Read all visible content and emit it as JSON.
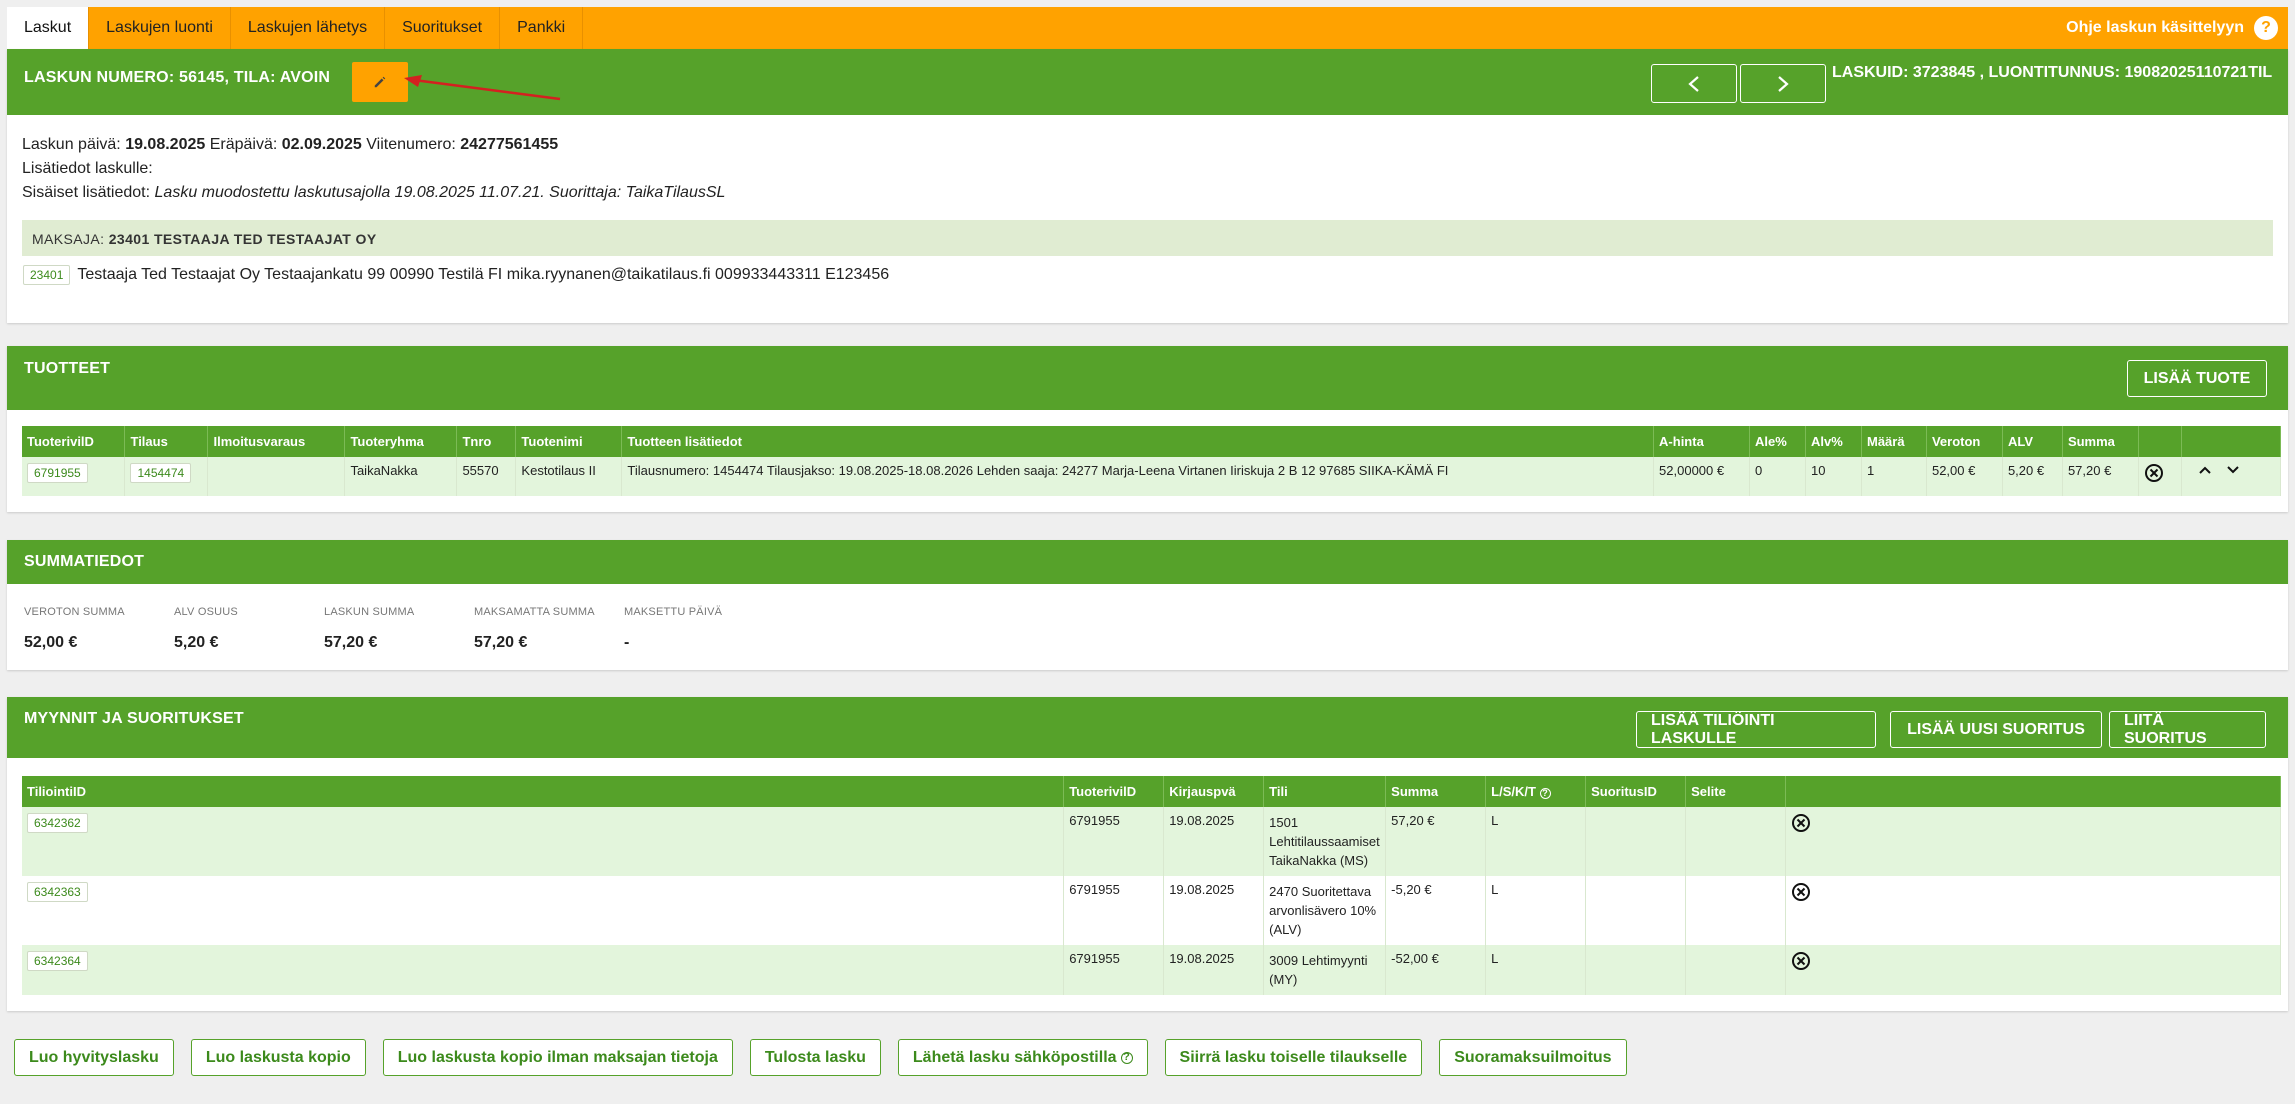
{
  "tabs": [
    {
      "label": "Laskut",
      "active": true
    },
    {
      "label": "Laskujen luonti",
      "active": false
    },
    {
      "label": "Laskujen lähetys",
      "active": false
    },
    {
      "label": "Suoritukset",
      "active": false
    },
    {
      "label": "Pankki",
      "active": false
    }
  ],
  "help": {
    "label": "Ohje laskun käsittelyyn",
    "icon": "?"
  },
  "invoice": {
    "title_prefix": "LASKUN NUMERO: 56145, TILA: ",
    "status": "AVOIN",
    "ids": "LASKUID: 3723845 , LUONTITUNNUS: 19082025110721TIL",
    "date_label": "Laskun päivä: ",
    "date": "19.08.2025",
    "due_label": " Eräpäivä: ",
    "due": "02.09.2025",
    "ref_label": " Viitenumero: ",
    "ref": "24277561455",
    "extra_label": "Lisätiedot laskulle:",
    "internal_label": "Sisäiset lisätiedot: ",
    "internal": "Lasku muodostettu laskutusajolla 19.08.2025 11.07.21. Suorittaja: TaikaTilausSL",
    "payer_label": "MAKSAJA: ",
    "payer": "23401 TESTAAJA TED TESTAAJAT OY",
    "payer_id": "23401",
    "payer_details": "Testaaja Ted Testaajat Oy Testaajankatu 99 00990 Testilä FI mika.ryynanen@taikatilaus.fi 009933443311 E123456"
  },
  "products": {
    "title": "TUOTTEET",
    "add_button": "LISÄÄ TUOTE",
    "headers": [
      "TuoterivilD",
      "Tilaus",
      "Ilmoitusvaraus",
      "Tuoteryhma",
      "Tnro",
      "Tuotenimi",
      "Tuotteen lisätiedot",
      "A-hinta",
      "Ale%",
      "Alv%",
      "Määrä",
      "Veroton",
      "ALV",
      "Summa",
      "",
      ""
    ],
    "row": {
      "id": "6791955",
      "order": "1454474",
      "reservation": "",
      "group": "TaikaNakka",
      "tnro": "55570",
      "name": "Kestotilaus II",
      "info": "Tilausnumero: 1454474 Tilausjakso: 19.08.2025-18.08.2026 Lehden saaja: 24277 Marja-Leena Virtanen Iiriskuja 2 B 12 97685 SIIKA-KÄMÄ FI",
      "price": "52,00000 €",
      "discount": "0",
      "vat": "10",
      "qty": "1",
      "net": "52,00 €",
      "vat_amount": "5,20 €",
      "total": "57,20 €"
    }
  },
  "summary": {
    "title": "SUMMATIEDOT",
    "items": [
      {
        "label": "VEROTON SUMMA",
        "value": "52,00 €"
      },
      {
        "label": "ALV OSUUS",
        "value": "5,20 €"
      },
      {
        "label": "LASKUN SUMMA",
        "value": "57,20 €"
      },
      {
        "label": "MAKSAMATTA SUMMA",
        "value": "57,20 €"
      },
      {
        "label": "MAKSETTU PÄIVÄ",
        "value": "-"
      }
    ]
  },
  "sales": {
    "title": "MYYNNIT JA SUORITUKSET",
    "buttons": [
      "LISÄÄ TILIÖINTI LASKULLE",
      "LISÄÄ UUSI SUORITUS",
      "LIITÄ SUORITUS"
    ],
    "headers": [
      "TiliointiID",
      "TuoterivilD",
      "Kirjauspvä",
      "Tili",
      "Summa",
      "L/S/K/T",
      "SuoritusID",
      "Selite",
      ""
    ],
    "rows": [
      {
        "id": "6342362",
        "row_id": "6791955",
        "date": "19.08.2025",
        "account": "1501 Lehtitilaussaamiset TaikaNakka (MS)",
        "sum": "57,20 €",
        "lskt": "L",
        "payment_id": "",
        "note": ""
      },
      {
        "id": "6342363",
        "row_id": "6791955",
        "date": "19.08.2025",
        "account": "2470 Suoritettava arvonlisävero 10% (ALV)",
        "sum": "-5,20 €",
        "lskt": "L",
        "payment_id": "",
        "note": ""
      },
      {
        "id": "6342364",
        "row_id": "6791955",
        "date": "19.08.2025",
        "account": "3009 Lehtimyynti (MY)",
        "sum": "-52,00 €",
        "lskt": "L",
        "payment_id": "",
        "note": ""
      }
    ]
  },
  "actions": [
    "Luo hyvityslasku",
    "Luo laskusta kopio",
    "Luo laskusta kopio ilman maksajan tietoja",
    "Tulosta lasku",
    "Lähetä lasku sähköpostilla",
    "Siirrä lasku toiselle tilaukselle",
    "Suoramaksuilmoitus"
  ],
  "colors": {
    "orange": "#ffa200",
    "green": "#56a22a",
    "light_green": "#e3f5dc",
    "arrow": "#d42020"
  }
}
